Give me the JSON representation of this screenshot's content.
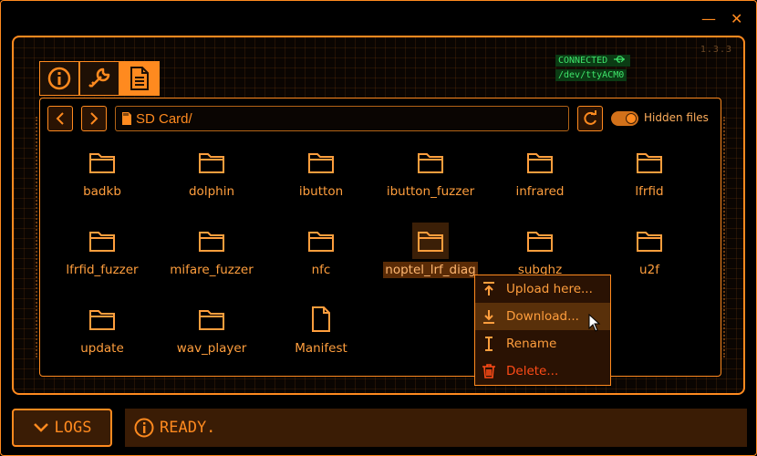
{
  "window": {
    "minimize_glyph": "—",
    "close_glyph": "✕"
  },
  "version": "1.3.3",
  "connection": {
    "status": "CONNECTED",
    "port": "/dev/ttyACM0",
    "icon": "usb-icon"
  },
  "tabs": [
    {
      "icon": "info-icon"
    },
    {
      "icon": "wrench-icon"
    },
    {
      "icon": "file-icon",
      "active": true
    }
  ],
  "path": "SD Card/",
  "hidden_files_label": "Hidden files",
  "hidden_files_enabled": true,
  "items": [
    {
      "name": "badkb",
      "type": "folder"
    },
    {
      "name": "dolphin",
      "type": "folder"
    },
    {
      "name": "ibutton",
      "type": "folder"
    },
    {
      "name": "ibutton_fuzzer",
      "type": "folder"
    },
    {
      "name": "infrared",
      "type": "folder"
    },
    {
      "name": "lfrfid",
      "type": "folder"
    },
    {
      "name": "lfrfid_fuzzer",
      "type": "folder"
    },
    {
      "name": "mifare_fuzzer",
      "type": "folder"
    },
    {
      "name": "nfc",
      "type": "folder"
    },
    {
      "name": "noptel_lrf_diag",
      "type": "folder",
      "selected": true
    },
    {
      "name": "subghz",
      "type": "folder"
    },
    {
      "name": "u2f",
      "type": "folder"
    },
    {
      "name": "update",
      "type": "folder"
    },
    {
      "name": "wav_player",
      "type": "folder"
    },
    {
      "name": "Manifest",
      "type": "file"
    }
  ],
  "context_menu": [
    {
      "label": "Upload here...",
      "icon": "upload-icon"
    },
    {
      "label": "Download...",
      "icon": "download-icon",
      "highlighted": true
    },
    {
      "label": "Rename",
      "icon": "text-cursor-icon"
    },
    {
      "label": "Delete...",
      "icon": "trash-icon",
      "danger": true
    }
  ],
  "logs_label": "LOGS",
  "status_text": "READY.",
  "colors": {
    "accent": "#ff8a1f",
    "connected_bg": "#0b3b14",
    "connected_fg": "#3ee66b",
    "danger": "#ff4b17"
  }
}
